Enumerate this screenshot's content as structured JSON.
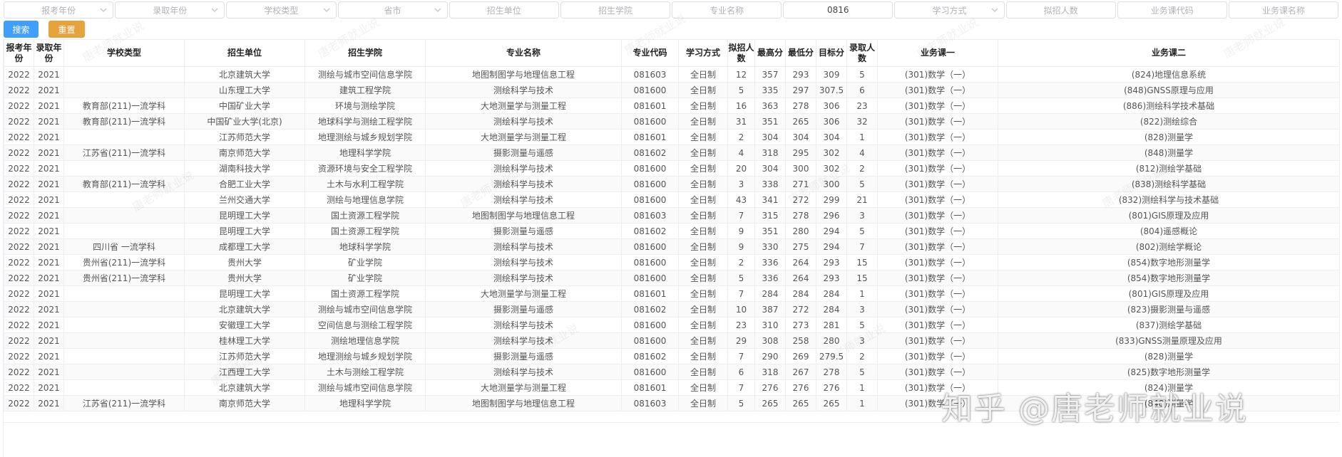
{
  "filters": [
    {
      "placeholder": "报考年份",
      "value": "",
      "dropdown": true
    },
    {
      "placeholder": "录取年份",
      "value": "",
      "dropdown": true
    },
    {
      "placeholder": "学校类型",
      "value": "",
      "dropdown": true
    },
    {
      "placeholder": "省市",
      "value": "",
      "dropdown": true
    },
    {
      "placeholder": "招生单位",
      "value": "",
      "dropdown": false
    },
    {
      "placeholder": "招生学院",
      "value": "",
      "dropdown": false
    },
    {
      "placeholder": "专业名称",
      "value": "",
      "dropdown": false
    },
    {
      "placeholder": "",
      "value": "0816",
      "dropdown": false
    },
    {
      "placeholder": "学习方式",
      "value": "",
      "dropdown": true
    },
    {
      "placeholder": "拟招人数",
      "value": "",
      "dropdown": false
    },
    {
      "placeholder": "业务课代码",
      "value": "",
      "dropdown": false
    },
    {
      "placeholder": "业务课名称",
      "value": "",
      "dropdown": false
    }
  ],
  "actions": {
    "search_label": "搜索",
    "reset_label": "重置"
  },
  "table": {
    "columns": [
      "报考年份",
      "录取年份",
      "学校类型",
      "招生单位",
      "招生学院",
      "专业名称",
      "专业代码",
      "学习方式",
      "拟招人数",
      "最高分",
      "最低分",
      "目标分",
      "录取人数",
      "业务课一",
      "业务课二"
    ],
    "rows": [
      [
        "2022",
        "2021",
        "",
        "北京建筑大学",
        "测绘与城市空间信息学院",
        "地图制图学与地理信息工程",
        "081603",
        "全日制",
        "12",
        "357",
        "293",
        "309",
        "5",
        "(301)数学（一）",
        "(824)地理信息系统"
      ],
      [
        "2022",
        "2021",
        "",
        "山东理工大学",
        "建筑工程学院",
        "测绘科学与技术",
        "081600",
        "全日制",
        "5",
        "335",
        "297",
        "307.5",
        "6",
        "(301)数学（一）",
        "(848)GNSS原理与应用"
      ],
      [
        "2022",
        "2021",
        "教育部(211)一流学科",
        "中国矿业大学",
        "环境与测绘学院",
        "大地测量学与测量工程",
        "081601",
        "全日制",
        "16",
        "363",
        "278",
        "306",
        "23",
        "(301)数学（一）",
        "(886)测绘科学技术基础"
      ],
      [
        "2022",
        "2021",
        "教育部(211)一流学科",
        "中国矿业大学(北京)",
        "地球科学与测绘工程学院",
        "测绘科学与技术",
        "081600",
        "全日制",
        "31",
        "351",
        "265",
        "306",
        "32",
        "(301)数学（一）",
        "(822)测绘综合"
      ],
      [
        "2022",
        "2021",
        "",
        "江苏师范大学",
        "地理测绘与城乡规划学院",
        "大地测量学与测量工程",
        "081601",
        "全日制",
        "2",
        "304",
        "304",
        "304",
        "1",
        "(301)数学（一）",
        "(828)测量学"
      ],
      [
        "2022",
        "2021",
        "江苏省(211)一流学科",
        "南京师范大学",
        "地理科学学院",
        "摄影测量与遥感",
        "081602",
        "全日制",
        "4",
        "318",
        "295",
        "302",
        "4",
        "(301)数学（一）",
        "(848)测量学"
      ],
      [
        "2022",
        "2021",
        "",
        "湖南科技大学",
        "资源环境与安全工程学院",
        "测绘科学与技术",
        "081600",
        "全日制",
        "20",
        "304",
        "300",
        "302",
        "2",
        "(301)数学（一）",
        "(812)测绘学基础"
      ],
      [
        "2022",
        "2021",
        "教育部(211)一流学科",
        "合肥工业大学",
        "土木与水利工程学院",
        "测绘科学与技术",
        "081600",
        "全日制",
        "3",
        "338",
        "271",
        "300",
        "5",
        "(301)数学（一）",
        "(838)测绘科学基础"
      ],
      [
        "2022",
        "2021",
        "",
        "兰州交通大学",
        "测绘与地理信息学院",
        "测绘科学与技术",
        "081600",
        "全日制",
        "43",
        "341",
        "272",
        "299",
        "21",
        "(301)数学（一）",
        "(832)测绘科学与技术基础"
      ],
      [
        "2022",
        "2021",
        "",
        "昆明理工大学",
        "国土资源工程学院",
        "地图制图学与地理信息工程",
        "081603",
        "全日制",
        "7",
        "315",
        "278",
        "296",
        "3",
        "(301)数学（一）",
        "(801)GIS原理及应用"
      ],
      [
        "2022",
        "2021",
        "",
        "昆明理工大学",
        "国土资源工程学院",
        "摄影测量与遥感",
        "081602",
        "全日制",
        "9",
        "351",
        "280",
        "294",
        "5",
        "(301)数学（一）",
        "(804)遥感概论"
      ],
      [
        "2022",
        "2021",
        "四川省 一流学科",
        "成都理工大学",
        "地球科学学院",
        "测绘科学与技术",
        "081600",
        "全日制",
        "9",
        "330",
        "275",
        "294",
        "7",
        "(301)数学（一）",
        "(802)测绘学概论"
      ],
      [
        "2022",
        "2021",
        "贵州省(211)一流学科",
        "贵州大学",
        "矿业学院",
        "测绘科学与技术",
        "081600",
        "全日制",
        "2",
        "336",
        "264",
        "293",
        "15",
        "(301)数学（一）",
        "(854)数字地形测量学"
      ],
      [
        "2022",
        "2021",
        "贵州省(211)一流学科",
        "贵州大学",
        "矿业学院",
        "测绘科学与技术",
        "081600",
        "全日制",
        "5",
        "336",
        "264",
        "293",
        "15",
        "(301)数学（一）",
        "(854)数字地形测量学"
      ],
      [
        "2022",
        "2021",
        "",
        "昆明理工大学",
        "国土资源工程学院",
        "大地测量学与测量工程",
        "081601",
        "全日制",
        "7",
        "284",
        "284",
        "284",
        "1",
        "(301)数学（一）",
        "(801)GIS原理及应用"
      ],
      [
        "2022",
        "2021",
        "",
        "北京建筑大学",
        "测绘与城市空间信息学院",
        "摄影测量与遥感",
        "081602",
        "全日制",
        "10",
        "387",
        "272",
        "284",
        "3",
        "(301)数学（一）",
        "(823)摄影测量与遥感"
      ],
      [
        "2022",
        "2021",
        "",
        "安徽理工大学",
        "空间信息与测绘工程学院",
        "测绘科学与技术",
        "081600",
        "全日制",
        "23",
        "310",
        "273",
        "281",
        "5",
        "(301)数学（一）",
        "(837)测绘学基础"
      ],
      [
        "2022",
        "2021",
        "",
        "桂林理工大学",
        "测绘地理信息学院",
        "测绘科学与技术",
        "081600",
        "全日制",
        "29",
        "308",
        "258",
        "280",
        "3",
        "(301)数学（一）",
        "(833)GNSS测量原理及应用"
      ],
      [
        "2022",
        "2021",
        "",
        "江苏师范大学",
        "地理测绘与城乡规划学院",
        "摄影测量与遥感",
        "081602",
        "全日制",
        "7",
        "290",
        "269",
        "279.5",
        "2",
        "(301)数学（一）",
        "(828)测量学"
      ],
      [
        "2022",
        "2021",
        "",
        "江西理工大学",
        "土木与测绘工程学院",
        "测绘科学与技术",
        "081600",
        "全日制",
        "6",
        "318",
        "267",
        "278",
        "5",
        "(301)数学（一）",
        "(825)数字地形测量学"
      ],
      [
        "2022",
        "2021",
        "",
        "北京建筑大学",
        "测绘与城市空间信息学院",
        "大地测量学与测量工程",
        "081601",
        "全日制",
        "7",
        "276",
        "276",
        "276",
        "1",
        "(301)数学（一）",
        "(824)测量学"
      ],
      [
        "2022",
        "2021",
        "江苏省(211)一流学科",
        "南京师范大学",
        "地理科学学院",
        "地图制图学与地理信息工程",
        "081603",
        "全日制",
        "5",
        "265",
        "265",
        "265",
        "1",
        "(301)数学（一）",
        "(848)测量学"
      ]
    ]
  },
  "watermark": {
    "text": "唐老师就业说",
    "logo": "知乎 @唐老师就业说"
  }
}
